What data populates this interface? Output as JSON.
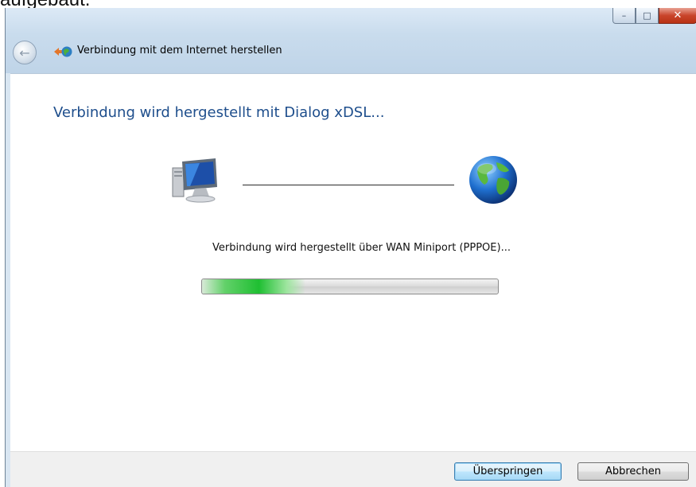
{
  "outer_caption": "aufgebaut.",
  "window": {
    "caption_buttons": {
      "minimize": "–",
      "maximize": "□",
      "close": "✕"
    },
    "back_button_glyph": "←",
    "wizard_title": "Verbindung mit dem Internet herstellen"
  },
  "main": {
    "heading": "Verbindung wird hergestellt mit Dialog xDSL...",
    "status": "Verbindung wird hergestellt über WAN Miniport (PPPOE)...",
    "progress_fill_fraction": 0.35,
    "icons": {
      "left": "computer-icon",
      "right": "globe-icon"
    }
  },
  "footer": {
    "skip_label": "Überspringen",
    "cancel_label": "Abbrechen"
  },
  "colors": {
    "heading": "#1e4e8c",
    "progress": "#1fbf32",
    "close_button": "#c9452b"
  }
}
